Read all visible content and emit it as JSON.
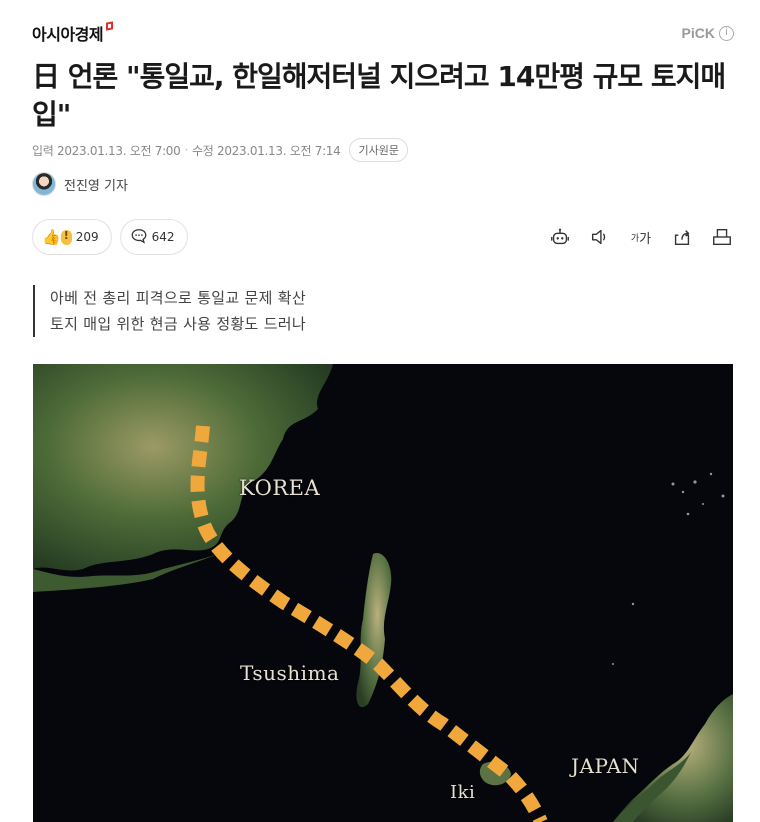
{
  "header": {
    "press_name": "아시아경제",
    "pick_label": "PiCK",
    "info_icon": "info-icon"
  },
  "article": {
    "title": "日 언론 \"통일교, 한일해저터널 지으려고 14만평 규모 토지매입\"",
    "meta": {
      "input_label": "입력",
      "input_time": "2023.01.13. 오전 7:00",
      "separator": "·",
      "edit_label": "수정",
      "edit_time": "2023.01.13. 오전 7:14",
      "origin_button": "기사원문"
    },
    "reporter": "전진영 기자",
    "reactions": {
      "like_count": "209",
      "comment_count": "642"
    },
    "tools": [
      "robot-icon",
      "speaker-icon",
      "font-size-icon",
      "share-icon",
      "print-icon"
    ],
    "font_tool_label_small": "가",
    "font_tool_label_large": "가",
    "summary": [
      "아베 전 총리 피격으로 통일교 문제 확산",
      "토지 매입 위한 현금 사용 정황도 드러나"
    ],
    "image": {
      "labels": {
        "korea": "KOREA",
        "tsushima": "Tsushima",
        "japan": "JAPAN",
        "iki": "Iki"
      },
      "route_color": "#f0a83c"
    }
  }
}
